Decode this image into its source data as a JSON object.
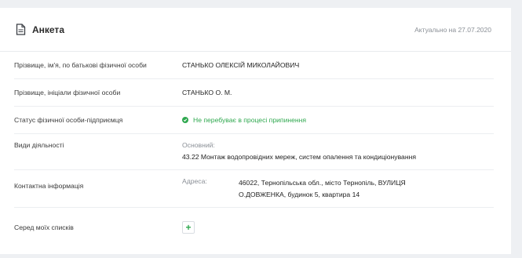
{
  "header": {
    "title": "Анкета",
    "icon": "document-icon",
    "actual_date": "Актуально на 27.07.2020"
  },
  "rows": {
    "full_name": {
      "label": "Прізвище, ім'я, по батькові фізичної особи",
      "value": "СТАНЬКО ОЛЕКСІЙ МИКОЛАЙОВИЧ"
    },
    "initials": {
      "label": "Прізвище, ініціали фізичної особи",
      "value": "СТАНЬКО О. М."
    },
    "status": {
      "label": "Статус фізичної особи-підприємця",
      "value": "Не перебуває в процесі припинення",
      "color": "#2fa84f"
    },
    "activities": {
      "label": "Види діяльності",
      "main_label": "Основний:",
      "main_value": "43.22 Монтаж водопровідних мереж, систем опалення та кондиціонування"
    },
    "contact": {
      "label": "Контактна інформація",
      "address_label": "Адреса:",
      "address_line1": "46022, Тернопільська обл., місто Тернопіль, ВУЛИЦЯ",
      "address_line2": "О.ДОВЖЕНКА, будинок 5, квартира 14"
    },
    "lists": {
      "label": "Серед моїх списків",
      "add_label": "+"
    }
  }
}
